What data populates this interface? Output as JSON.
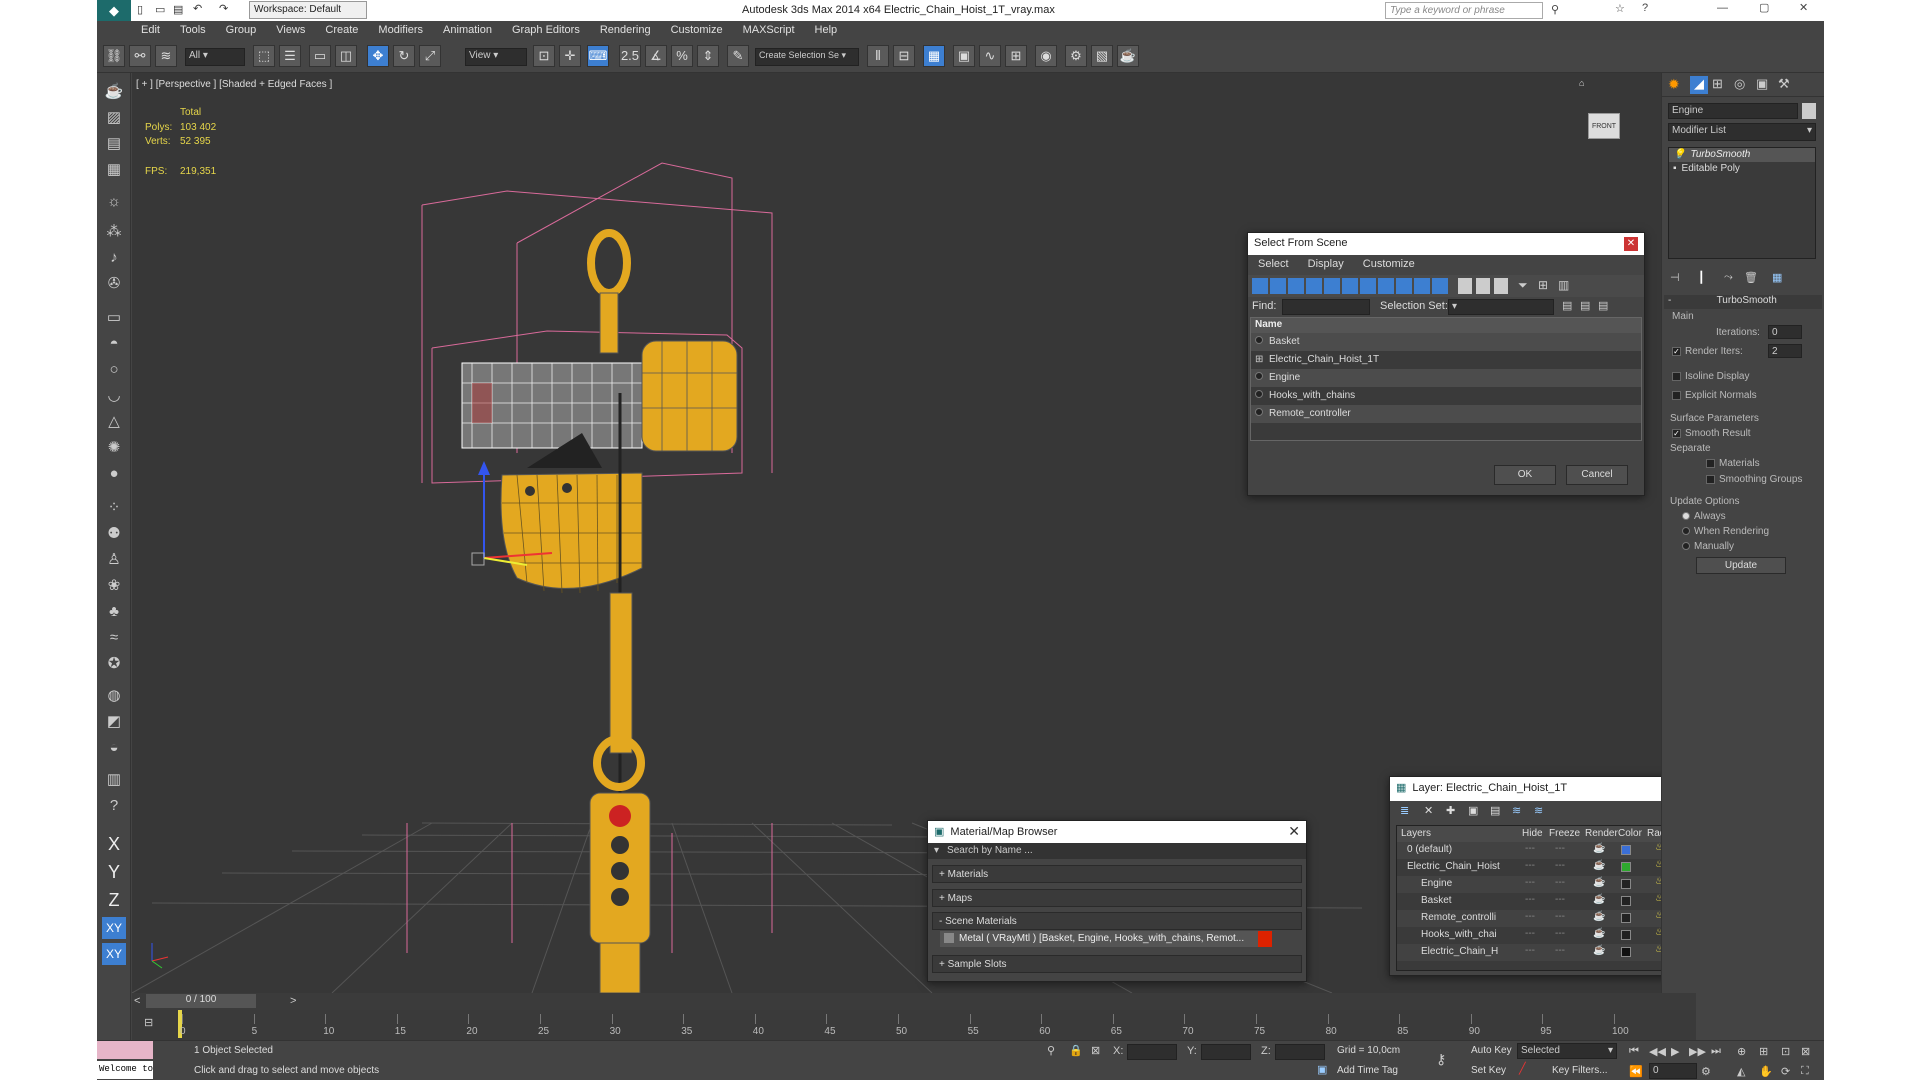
{
  "titlebar": {
    "workspace": "Workspace: Default",
    "title": "Autodesk 3ds Max  2014 x64     Electric_Chain_Hoist_1T_vray.max",
    "search_placeholder": "Type a keyword or phrase"
  },
  "menu": [
    "Edit",
    "Tools",
    "Group",
    "Views",
    "Create",
    "Modifiers",
    "Animation",
    "Graph Editors",
    "Rendering",
    "Customize",
    "MAXScript",
    "Help"
  ],
  "toolbar": {
    "filter": "All",
    "refcoord": "View",
    "selset": "Create Selection Se"
  },
  "viewport": {
    "label": "[ + ] [Perspective ] [Shaded + Edged Faces ]",
    "stats": {
      "total": "Total",
      "polys_label": "Polys:",
      "polys": "103 402",
      "verts_label": "Verts:",
      "verts": "52 395",
      "fps_label": "FPS:",
      "fps": "219,351"
    },
    "viewcube": "FRONT"
  },
  "select_dialog": {
    "title": "Select From Scene",
    "menu": [
      "Select",
      "Display",
      "Customize"
    ],
    "find_label": "Find:",
    "selset_label": "Selection Set:",
    "col_name": "Name",
    "items": [
      "Basket",
      "Electric_Chain_Hoist_1T",
      "Engine",
      "Hooks_with_chains",
      "Remote_controller"
    ],
    "ok": "OK",
    "cancel": "Cancel"
  },
  "material_browser": {
    "title": "Material/Map Browser",
    "search": "Search by Name ...",
    "sections": [
      "+ Materials",
      "+ Maps",
      "- Scene Materials",
      "+ Sample Slots"
    ],
    "scene_material": "Metal  ( VRayMtl )  [Basket, Engine, Hooks_with_chains, Remot..."
  },
  "layer_dialog": {
    "title": "Layer: Electric_Chain_Hoist_1T",
    "help": "?",
    "cols": [
      "Layers",
      "Hide",
      "Freeze",
      "Render",
      "Color",
      "Radiosity"
    ],
    "rows": [
      "0 (default)",
      "Electric_Chain_Hoist",
      "Engine",
      "Basket",
      "Remote_controlli",
      "Hooks_with_chai",
      "Electric_Chain_H"
    ],
    "row_colors": [
      "#3b6fd6",
      "#2ea82e",
      "#222222",
      "#222222",
      "#222222",
      "#222222",
      "#111111"
    ]
  },
  "cmdpanel": {
    "object_name": "Engine",
    "modifier_list": "Modifier List",
    "stack": [
      "TurboSmooth",
      "Editable Poly"
    ],
    "rollout": "TurboSmooth",
    "main": "Main",
    "iterations_label": "Iterations:",
    "iterations": "0",
    "render_iters_label": "Render Iters:",
    "render_iters": "2",
    "isoline": "Isoline Display",
    "explicit": "Explicit Normals",
    "surface": "Surface Parameters",
    "smooth_result": "Smooth Result",
    "separate": "Separate",
    "materials": "Materials",
    "smoothing_groups": "Smoothing Groups",
    "update_options": "Update Options",
    "always": "Always",
    "when_rendering": "When Rendering",
    "manually": "Manually",
    "update": "Update"
  },
  "timeline": {
    "frame": "0 / 100",
    "ticks": [
      "0",
      "5",
      "10",
      "15",
      "20",
      "25",
      "30",
      "35",
      "40",
      "45",
      "50",
      "55",
      "60",
      "65",
      "70",
      "75",
      "80",
      "85",
      "90",
      "95",
      "100"
    ]
  },
  "status": {
    "selected": "1 Object Selected",
    "prompt": "Click and drag to select and move objects",
    "welcome": "Welcome to M",
    "x": "X:",
    "y": "Y:",
    "z": "Z:",
    "grid": "Grid = 10,0cm",
    "add_time_tag": "Add Time Tag",
    "auto_key": "Auto Key",
    "set_key": "Set Key",
    "selected_dd": "Selected",
    "key_filters": "Key Filters...",
    "frame_val": "0"
  },
  "axis_buttons": [
    "X",
    "Y",
    "Z",
    "XY",
    "XY"
  ]
}
